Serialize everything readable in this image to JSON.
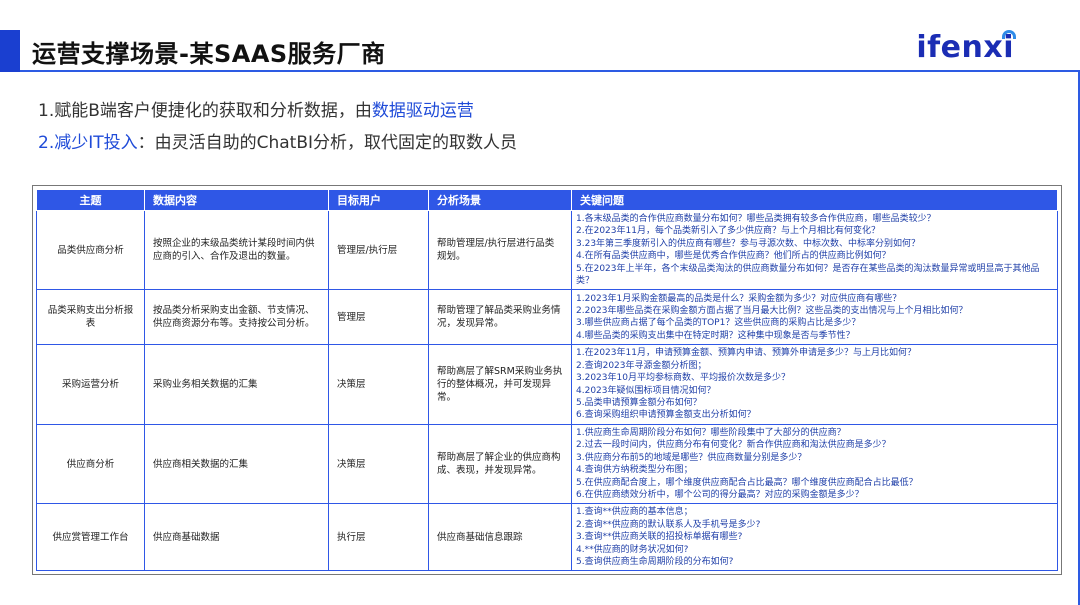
{
  "header": {
    "title": "运营支撑场景-某SAAS服务厂商",
    "logo": "ifenxi"
  },
  "points": [
    {
      "prefix": "1.赋能B端客户便捷化的获取和分析数据，由",
      "highlight": "数据驱动运营"
    },
    {
      "highlight": "2.减少IT投入",
      "suffix": "：由灵活自助的ChatBI分析，取代固定的取数人员"
    }
  ],
  "table": {
    "columns": [
      "主题",
      "数据内容",
      "目标用户",
      "分析场景",
      "关键问题"
    ],
    "rows": [
      {
        "topic": "品类供应商分析",
        "content": "按照企业的末级品类统计某段时间内供应商的引入、合作及退出的数量。",
        "user": "管理层/执行层",
        "scene": "帮助管理层/执行层进行品类规划。",
        "questions": [
          "1.各末级品类的合作供应商数量分布如何？哪些品类拥有较多合作供应商，哪些品类较少？",
          "2.在2023年11月，每个品类新引入了多少供应商？与上个月相比有何变化？",
          "3.23年第三季度新引入的供应商有哪些？参与寻源次数、中标次数、中标率分别如何？",
          "4.在所有品类供应商中，哪些是优秀合作供应商？他们所占的供应商比例如何？",
          "5.在2023年上半年，各个末级品类淘汰的供应商数量分布如何？是否存在某些品类的淘汰数量异常或明显高于其他品类？"
        ]
      },
      {
        "topic": "品类采购支出分析报表",
        "content": "按品类分析采购支出金额、节支情况、供应商资源分布等。支持按公司分析。",
        "user": "管理层",
        "scene": "帮助管理了解品类采购业务情况，发现异常。",
        "questions": [
          "1.2023年1月采购金额最高的品类是什么？采购金额为多少？对应供应商有哪些？",
          "2.2023年哪些品类在采购金额方面占据了当月最大比例？这些品类的支出情况与上个月相比如何？",
          "3.哪些供应商占据了每个品类的TOP1？这些供应商的采购占比是多少？",
          "4.哪些品类的采购支出集中在特定时期？这种集中现象是否与季节性？"
        ]
      },
      {
        "topic": "采购运营分析",
        "content": "采购业务相关数据的汇集",
        "user": "决策层",
        "scene": "帮助高层了解SRM采购业务执行的整体概况，并可发现异常。",
        "questions": [
          "1.在2023年11月，申请预算金额、预算内申请、预算外申请是多少？与上月比如何？",
          "2.查询2023年寻源金额分析图；",
          "3.2023年10月平均参标商数、平均报价次数是多少？",
          "4.2023年疑似围标项目情况如何？",
          "5.品类申请预算金额分布如何？",
          "6.查询采购组织申请预算金额支出分析如何？"
        ]
      },
      {
        "topic": "供应商分析",
        "content": "供应商相关数据的汇集",
        "user": "决策层",
        "scene": "帮助高层了解企业的供应商构成、表现，并发现异常。",
        "questions": [
          "1.供应商生命周期阶段分布如何？哪些阶段集中了大部分的供应商？",
          "2.过去一段时间内，供应商分布有何变化？新合作供应商和淘汰供应商是多少？",
          "3.供应商分布前5的地域是哪些？供应商数量分别是多少？",
          "4.查询供方纳税类型分布图；",
          "5.在供应商配合度上，哪个维度供应商配合占比最高？哪个维度供应商配合占比最低？",
          "6.在供应商绩效分析中，哪个公司的得分最高？对应的采购金额是多少？"
        ]
      },
      {
        "topic": "供应赏管理工作台",
        "content": "供应商基础数据",
        "user": "执行层",
        "scene": "供应商基础信息跟踪",
        "questions": [
          "1.查询**供应商的基本信息；",
          "2.查询**供应商的默认联系人及手机号是多少?",
          "3.查询**供应商关联的招投标单据有哪些?",
          "4.**供应商的财务状况如何?",
          "5.查询供应商生命周期阶段的分布如何?"
        ]
      }
    ]
  }
}
